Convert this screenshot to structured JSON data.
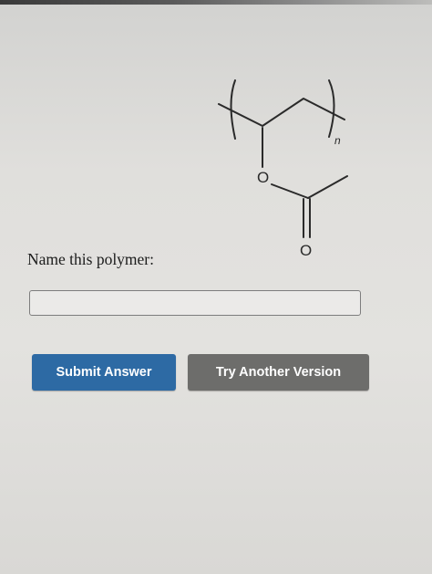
{
  "question": {
    "structure_labels": {
      "oxygen_ester": "O",
      "oxygen_carbonyl": "O",
      "repeat_subscript": "n"
    },
    "prompt": "Name this polymer:",
    "answer_value": "",
    "answer_placeholder": ""
  },
  "actions": {
    "submit_label": "Submit Answer",
    "try_another_label": "Try Another Version"
  },
  "colors": {
    "submit_button": "#2d6aa4",
    "try_another_button": "#6d6d6b",
    "text": "#1c1c1c",
    "bond_lines": "#2a2a2a"
  }
}
